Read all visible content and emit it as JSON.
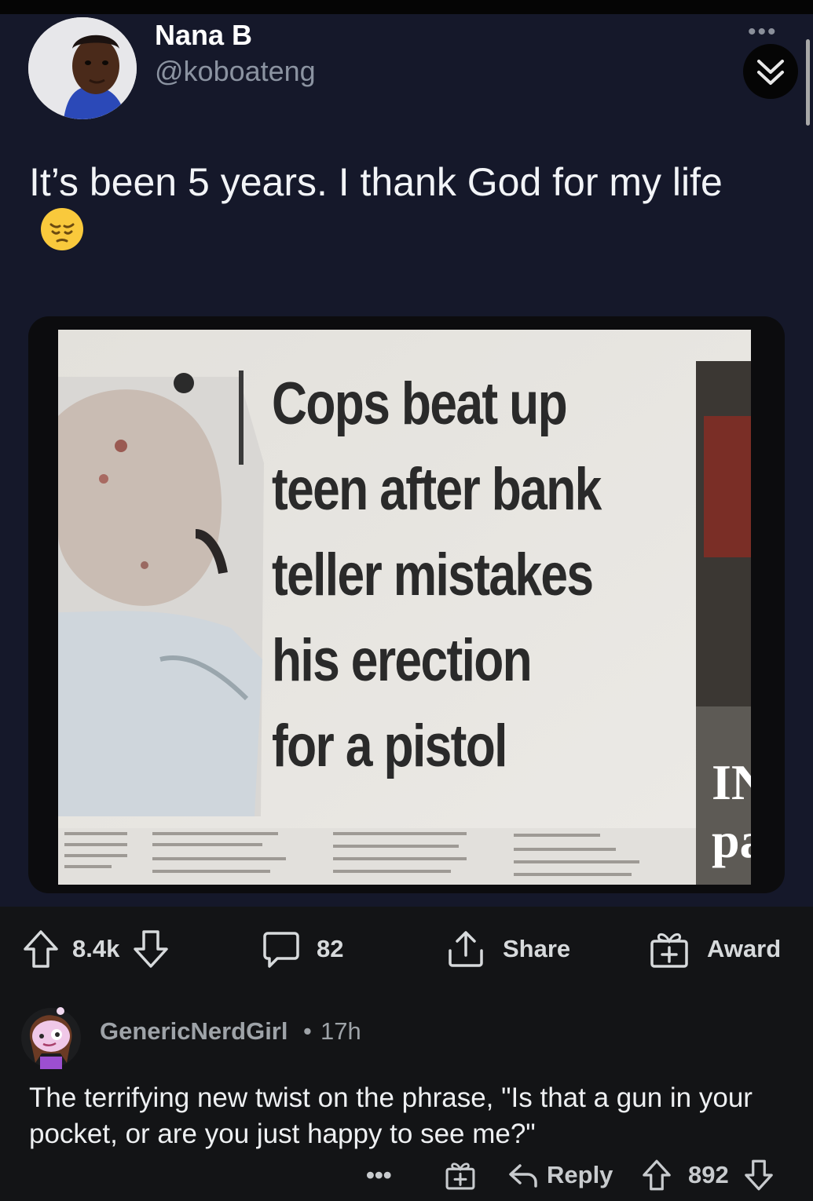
{
  "tweet": {
    "display_name": "Nana B",
    "handle": "@koboateng",
    "more_glyph": "•••",
    "text": "It’s been 5 years. I thank God for my life",
    "emoji_icon": "pensive-face-icon",
    "image": {
      "headline_lines": [
        "Cops beat up",
        "teen after bank",
        "teller mistakes",
        "his erection",
        "for a pistol"
      ],
      "side_lines": [
        "IN",
        "pa"
      ]
    }
  },
  "post_actions": {
    "upvote_count": "8.4k",
    "comments_count": "82",
    "share_label": "Share",
    "award_label": "Award"
  },
  "comment": {
    "author": "GenericNerdGirl",
    "separator": "•",
    "age": "17h",
    "body": "The terrifying new twist on the phrase, \"Is that a gun in your pocket, or are you just happy to see me?\"",
    "more_glyph": "•••",
    "reply_label": "Reply",
    "score": "892"
  },
  "colors": {
    "tweet_background": "#15182a",
    "app_background": "#131416",
    "text_primary": "#f2f4f7",
    "text_secondary": "#8b93a1"
  }
}
